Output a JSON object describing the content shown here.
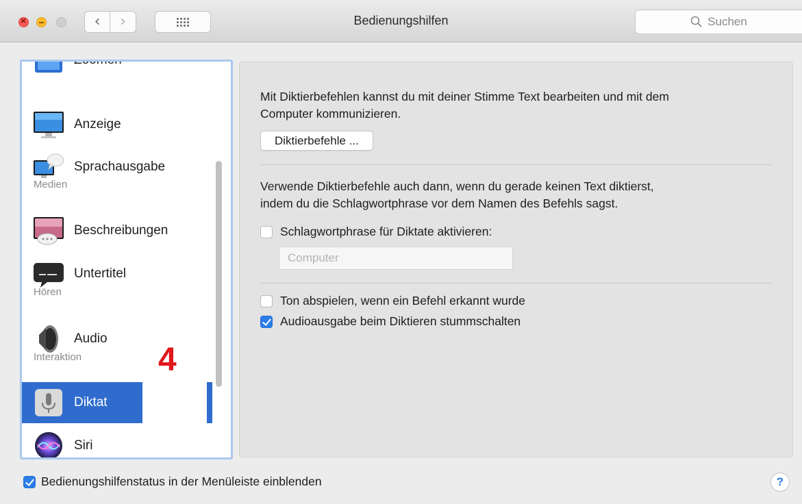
{
  "window": {
    "title": "Bedienungshilfen"
  },
  "search": {
    "placeholder": "Suchen"
  },
  "sidebar": {
    "partial_item": "Zoomen",
    "items": [
      {
        "label": "Anzeige",
        "icon": "display-icon"
      },
      {
        "label": "Sprachausgabe",
        "icon": "speech-icon"
      },
      {
        "label": "Beschreibungen",
        "icon": "descriptions-icon"
      },
      {
        "label": "Untertitel",
        "icon": "captions-icon"
      },
      {
        "label": "Audio",
        "icon": "speaker-icon"
      },
      {
        "label": "Diktat",
        "icon": "microphone-icon",
        "selected": true
      },
      {
        "label": "Siri",
        "icon": "siri-icon"
      }
    ],
    "headers": {
      "medien": "Medien",
      "hoeren": "Hören",
      "interaktion": "Interaktion"
    },
    "annotation": "4"
  },
  "panel": {
    "intro_line1": "Mit Diktierbefehlen kannst du mit deiner Stimme Text bearbeiten und mit dem",
    "intro_line2": "Computer kommunizieren.",
    "commands_button": "Diktierbefehle ...",
    "keyword_line1": "Verwende Diktierbefehle auch dann, wenn du gerade keinen Text diktierst,",
    "keyword_line2": "indem du die Schlagwortphrase vor dem Namen des Befehls sagst.",
    "keyword_checkbox": {
      "label": "Schlagwortphrase für Diktate aktivieren:",
      "checked": false
    },
    "keyword_field_placeholder": "Computer",
    "sound_checkbox": {
      "label": "Ton abspielen, wenn ein Befehl erkannt wurde",
      "checked": false
    },
    "mute_checkbox": {
      "label": "Audioausgabe beim Diktieren stummschalten",
      "checked": true
    }
  },
  "footer": {
    "status_checkbox": {
      "label": "Bedienungshilfenstatus in der Menüleiste einblenden",
      "checked": true
    },
    "help_label": "?"
  },
  "colors": {
    "accent": "#2f6ccd",
    "checkbox_on": "#2b7de9",
    "annotation": "#e0171b"
  }
}
